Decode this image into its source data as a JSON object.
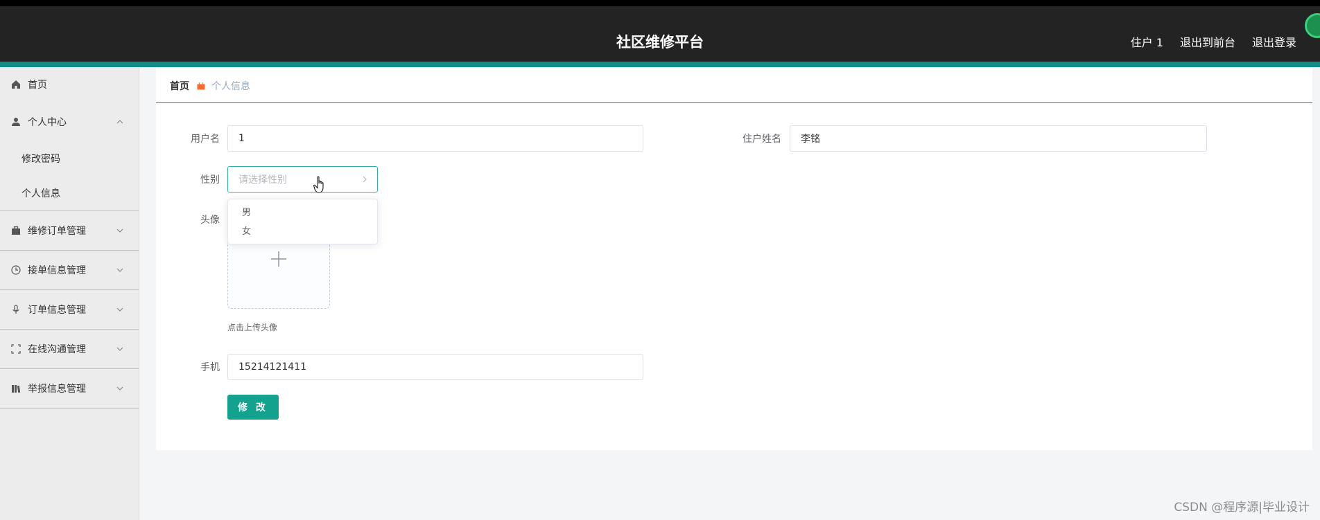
{
  "header": {
    "title": "社区维修平台",
    "links": [
      "住户 1",
      "退出到前台",
      "退出登录"
    ]
  },
  "sidebar": {
    "items": [
      {
        "label": "首页",
        "icon": "home-icon"
      },
      {
        "label": "个人中心",
        "icon": "user-icon",
        "expanded": true,
        "children": [
          "修改密码",
          "个人信息"
        ]
      },
      {
        "label": "维修订单管理",
        "icon": "briefcase-icon"
      },
      {
        "label": "接单信息管理",
        "icon": "clock-icon"
      },
      {
        "label": "订单信息管理",
        "icon": "microphone-icon"
      },
      {
        "label": "在线沟通管理",
        "icon": "fullscreen-icon"
      },
      {
        "label": "举报信息管理",
        "icon": "books-icon"
      }
    ]
  },
  "breadcrumb": {
    "home": "首页",
    "current": "个人信息"
  },
  "form": {
    "username_label": "用户名",
    "username_value": "1",
    "realname_label": "住户姓名",
    "realname_value": "李铭",
    "gender_label": "性别",
    "gender_placeholder": "请选择性别",
    "gender_options": [
      "男",
      "女"
    ],
    "avatar_label": "头像",
    "avatar_tip": "点击上传头像",
    "phone_label": "手机",
    "phone_value": "15214121411",
    "submit_label": "修 改"
  },
  "watermark": "CSDN @程序源|毕业设计",
  "colors": {
    "header_bg": "#232323",
    "accent": "#0f8d86",
    "button": "#12a28e",
    "breadcrumb_marker": "#f56c2d"
  }
}
